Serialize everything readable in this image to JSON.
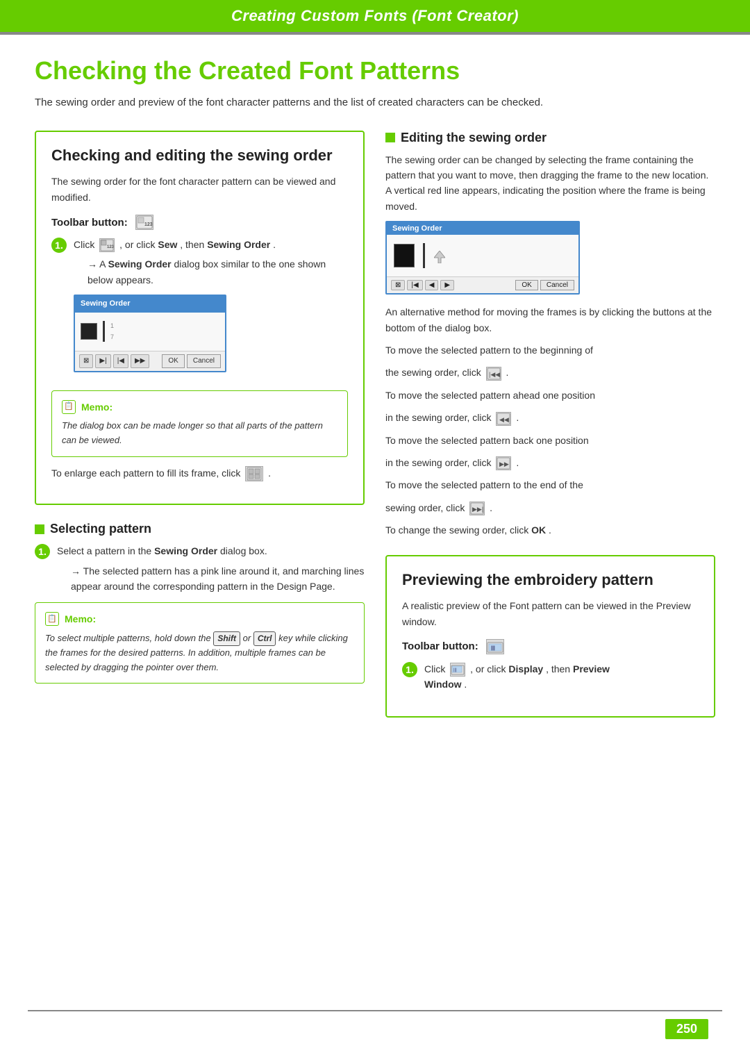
{
  "header": {
    "title": "Creating Custom Fonts (Font Creator)"
  },
  "page": {
    "title": "Checking the Created Font Patterns",
    "subtitle": "The sewing order and preview of the font character patterns and the list of created characters can be checked."
  },
  "left_section": {
    "box_title": "Checking and editing the sewing order",
    "box_desc": "The sewing order for the font character pattern can be viewed and modified.",
    "toolbar_label": "Toolbar button:",
    "step1_text": ", or click ",
    "step1_bold1": "Sew",
    "step1_comma": ", then ",
    "step1_bold2": "Sewing Order",
    "step1_result": "→ A ",
    "step1_result_bold": "Sewing Order",
    "step1_result2": " dialog box similar to the one shown below appears.",
    "memo1_header": "Memo:",
    "memo1_text": "The dialog box can be made longer so that all parts of the pattern can be viewed.",
    "enlarge_text": "To enlarge each pattern to fill its frame, click",
    "selecting_pattern_heading": "Selecting pattern",
    "step2_text": "Select a pattern in the ",
    "step2_bold": "Sewing Order",
    "step2_text2": " dialog box.",
    "step2_result": "→ The selected pattern has a pink line around it, and marching lines appear around the corresponding pattern in the Design Page.",
    "memo2_header": "Memo:",
    "memo2_text": "To select multiple patterns, hold down the",
    "memo2_shift": "Shift",
    "memo2_or": " or ",
    "memo2_ctrl": "Ctrl",
    "memo2_text2": " key while clicking the frames for the desired patterns. In addition, multiple frames can be selected by dragging the pointer over them."
  },
  "right_section": {
    "editing_heading": "Editing the sewing order",
    "editing_desc": "The sewing order can be changed by selecting the frame containing the pattern that you want to move, then dragging the frame to the new location. A vertical red line appears, indicating the position where the frame is being moved.",
    "alt_method": "An alternative method for moving the frames is by clicking the buttons at the bottom of the dialog box.",
    "move_beginning_text": "To move the selected pattern to the beginning of",
    "move_beginning_text2": "the sewing order, click",
    "move_ahead_text": "To move the selected pattern ahead one position",
    "move_ahead_text2": "in the sewing order, click",
    "move_back_text": "To move the selected pattern back one position",
    "move_back_text2": "in the sewing order, click",
    "move_end_text": "To move the selected pattern to the end of the",
    "move_end_text2": "sewing order, click",
    "change_order_text": "To change the sewing order, click ",
    "change_order_bold": "OK",
    "change_order_end": "."
  },
  "preview_section": {
    "box_title": "Previewing the embroidery pattern",
    "box_desc": "A realistic preview of the Font pattern can be viewed in the Preview window.",
    "toolbar_label": "Toolbar button:",
    "step1_text": ", or click ",
    "step1_bold1": "Display",
    "step1_comma": ", then ",
    "step1_bold2": "Preview Window",
    "step1_bold2b": "Window"
  },
  "page_number": "250",
  "dialogs": {
    "sewing_order": "Sewing Order",
    "ok_label": "OK",
    "cancel_label": "Cancel"
  }
}
